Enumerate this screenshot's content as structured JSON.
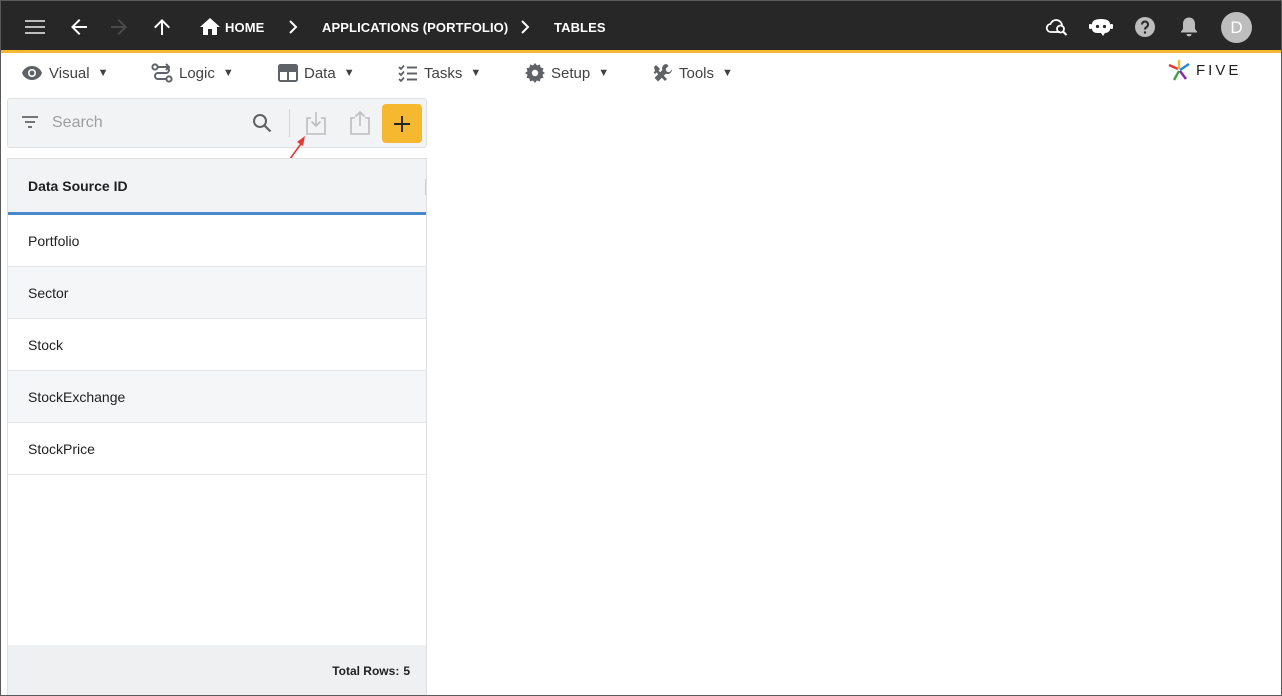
{
  "appbar": {
    "breadcrumbs": [
      {
        "label": "HOME"
      },
      {
        "label": "APPLICATIONS (PORTFOLIO)"
      },
      {
        "label": "TABLES"
      }
    ],
    "avatar_initial": "D"
  },
  "menubar": {
    "items": [
      {
        "label": "Visual",
        "icon": "eye-icon"
      },
      {
        "label": "Logic",
        "icon": "logic-flow-icon"
      },
      {
        "label": "Data",
        "icon": "table-icon"
      },
      {
        "label": "Tasks",
        "icon": "checklist-icon"
      },
      {
        "label": "Setup",
        "icon": "gear-icon"
      },
      {
        "label": "Tools",
        "icon": "tools-icon"
      }
    ],
    "caret": "▼",
    "logo_text": "FIVE"
  },
  "search": {
    "placeholder": "Search",
    "value": ""
  },
  "list": {
    "column_header": "Data Source ID",
    "rows": [
      {
        "label": "Portfolio"
      },
      {
        "label": "Sector"
      },
      {
        "label": "Stock"
      },
      {
        "label": "StockExchange"
      },
      {
        "label": "StockPrice"
      }
    ],
    "footer_label": "Total Rows:",
    "total_rows": "5"
  },
  "colors": {
    "appbar_bg": "#272727",
    "accent": "#f5b82e",
    "header_underline": "#4a87c9",
    "annotation_arrow": "#e53935"
  }
}
